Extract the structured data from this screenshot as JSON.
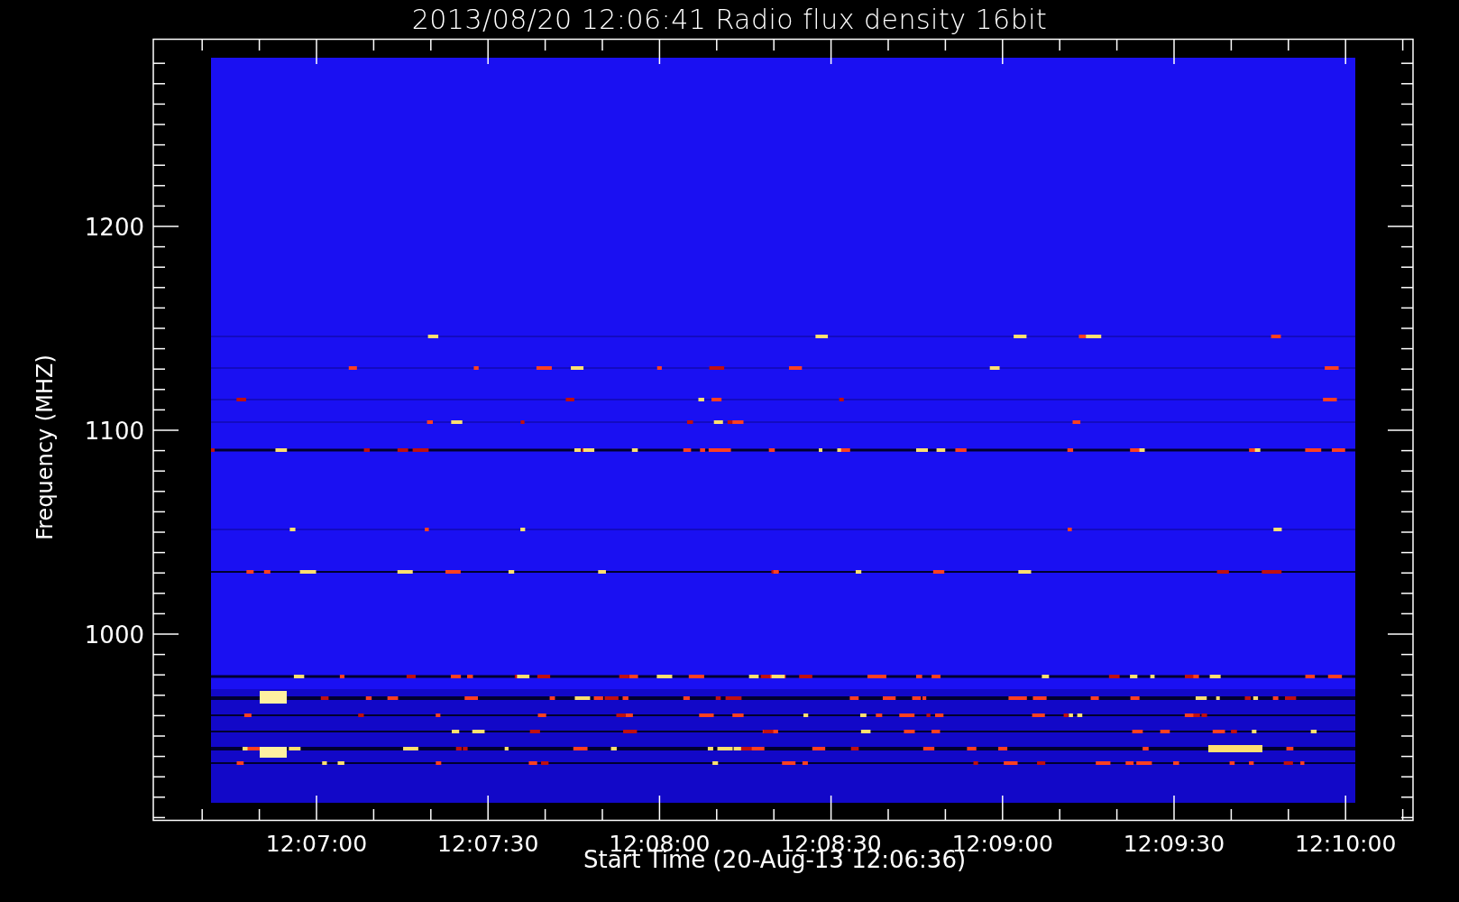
{
  "title": "2013/08/20 12:06:41 Radio flux density 16bit",
  "y_axis": {
    "label": "Frequency (MHZ)",
    "ticks": [
      "1200",
      "1100",
      "1000"
    ]
  },
  "x_axis": {
    "label": "Start Time (20-Aug-13 12:06:36)",
    "ticks": [
      "12:07:00",
      "12:07:30",
      "12:08:00",
      "12:08:30",
      "12:09:00",
      "12:09:30",
      "12:10:00"
    ]
  }
}
